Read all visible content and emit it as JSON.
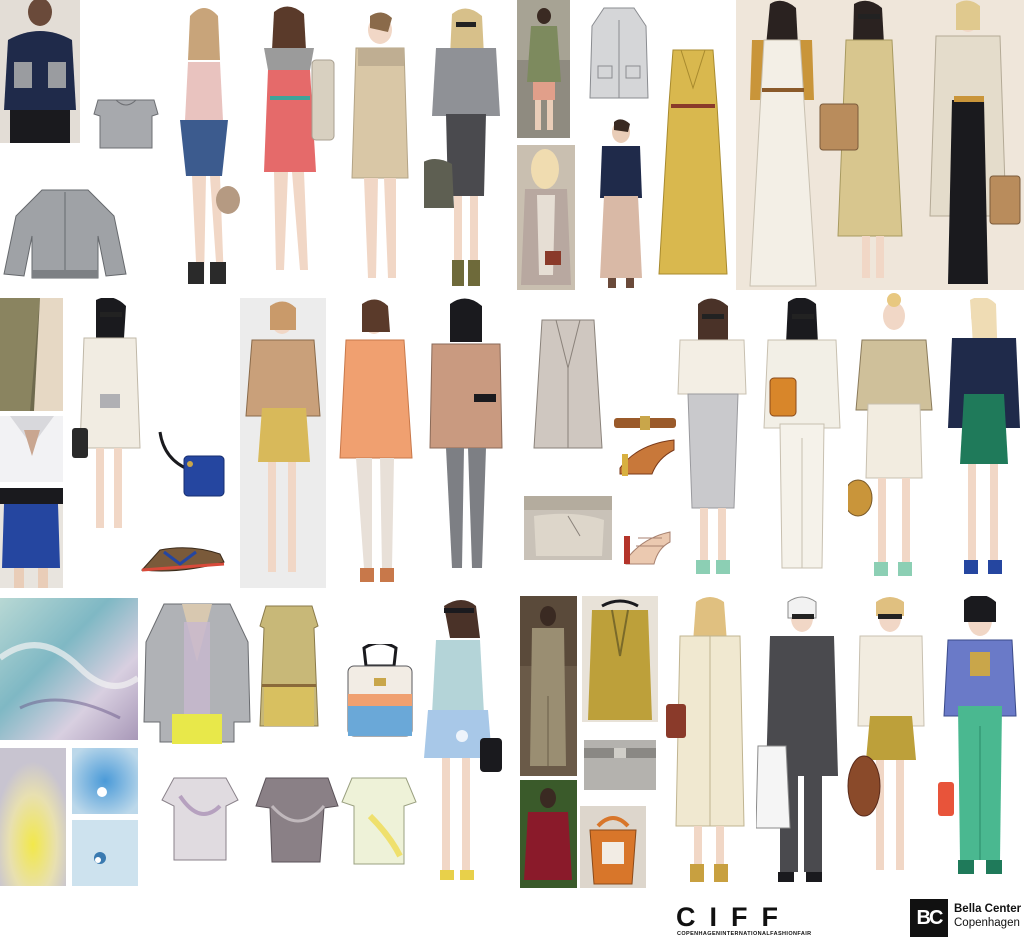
{
  "board": {
    "title": "",
    "colors": {
      "background": "#ffffff",
      "navy": "#1f2a4a",
      "grey": "#8c8e92",
      "coral": "#e56a6a",
      "sand": "#d9c7a6",
      "mustard": "#c9a64a",
      "camel": "#b98c5c",
      "peach": "#f0a070",
      "cobalt": "#2546a0",
      "emerald": "#1f7a5a",
      "mint": "#8ccfb4",
      "ivory": "#efe9d8",
      "charcoal": "#4a4a4e"
    }
  },
  "footer": {
    "ciff_logo_text": "CIFF",
    "ciff_tagline": "COPENHAGENINTERNATIONALFASHIONFAIR",
    "bc_logo_text": "BC",
    "bc_name": "Bella Center",
    "bc_city": "Copenhagen"
  }
}
